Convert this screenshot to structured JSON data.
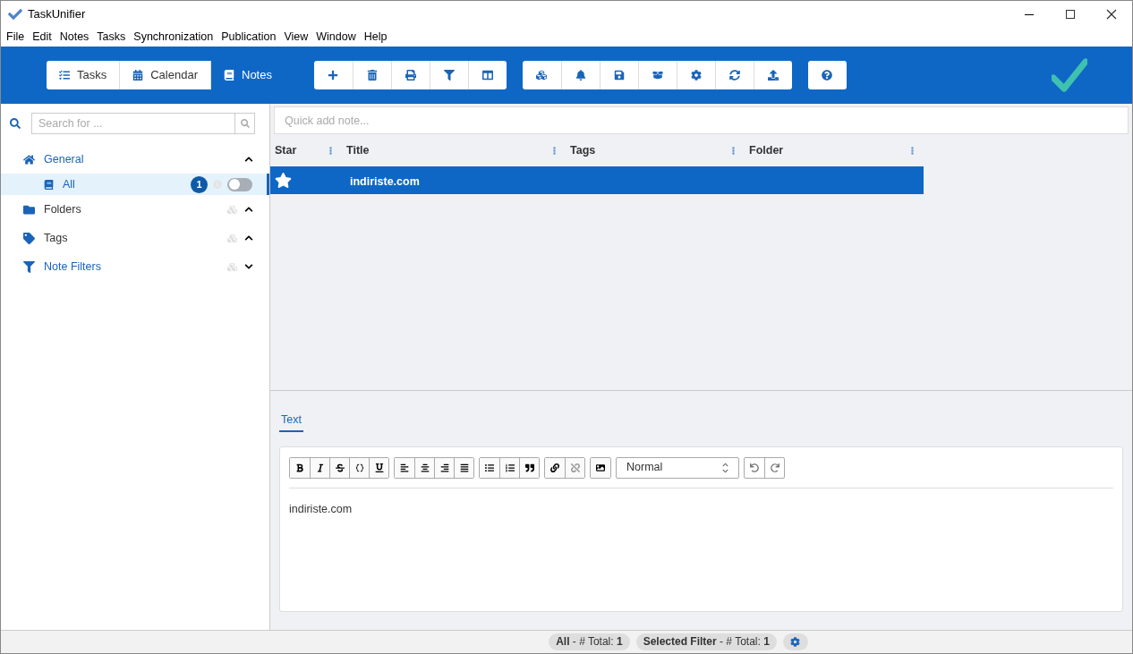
{
  "window": {
    "title": "TaskUnifier"
  },
  "menu": [
    "File",
    "Edit",
    "Notes",
    "Tasks",
    "Synchronization",
    "Publication",
    "View",
    "Window",
    "Help"
  ],
  "view_tabs": [
    {
      "label": "Tasks",
      "kind": "tasks",
      "selected": false
    },
    {
      "label": "Calendar",
      "kind": "calendar",
      "selected": false
    },
    {
      "label": "Notes",
      "kind": "notes",
      "selected": true
    }
  ],
  "sidebar": {
    "search": {
      "placeholder": "Search for ..."
    },
    "sections": [
      {
        "label": "General",
        "kind": "home",
        "color": "#1a64b8",
        "expanded": true,
        "children": [
          {
            "label": "All",
            "count": "1",
            "selected": true,
            "on": false
          }
        ]
      },
      {
        "label": "Folders",
        "kind": "folder",
        "color": "#333333",
        "expanded": true
      },
      {
        "label": "Tags",
        "kind": "tag",
        "color": "#333333",
        "expanded": true
      },
      {
        "label": "Note Filters",
        "kind": "filter",
        "color": "#1a64b8",
        "expanded": false
      }
    ]
  },
  "quick_add": {
    "placeholder": "Quick add note..."
  },
  "table": {
    "columns": [
      "Star",
      "Title",
      "Tags",
      "Folder"
    ],
    "rows": [
      {
        "starred": true,
        "title": "indiriste.com",
        "tags": "",
        "folder": "",
        "selected": true
      }
    ]
  },
  "editor": {
    "tabs": [
      {
        "label": "Text",
        "selected": true
      }
    ],
    "style_select": "Normal",
    "content": "indiriste.com"
  },
  "status_bar": [
    "**All** - # Total: **1**",
    "**Selected Filter** - # Total: **1**"
  ]
}
